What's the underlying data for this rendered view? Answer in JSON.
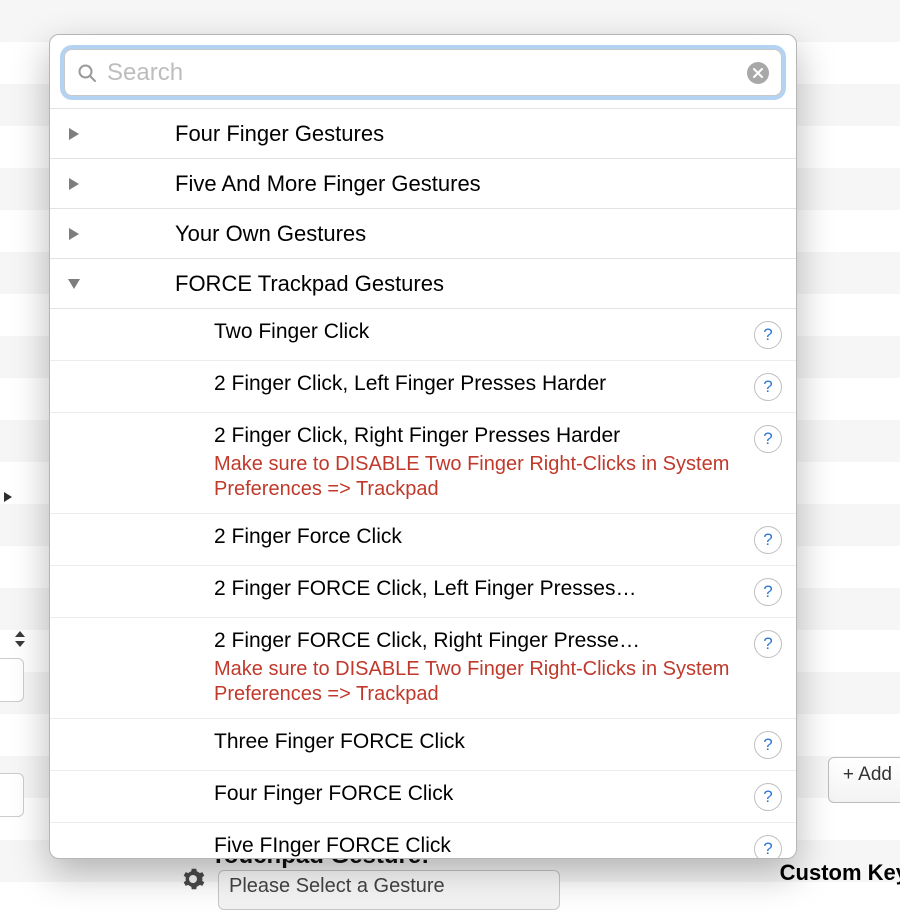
{
  "search": {
    "placeholder": "Search",
    "value": ""
  },
  "sections": [
    {
      "label": "Four Finger Gestures",
      "expanded": false
    },
    {
      "label": "Five And More Finger Gestures",
      "expanded": false
    },
    {
      "label": "Your Own Gestures",
      "expanded": false
    },
    {
      "label": "FORCE Trackpad Gestures",
      "expanded": true
    }
  ],
  "force_items": [
    {
      "title": "Two Finger Click",
      "note": ""
    },
    {
      "title": "2 Finger Click, Left Finger Presses Harder",
      "note": ""
    },
    {
      "title": "2 Finger Click, Right Finger Presses Harder",
      "note": "Make sure to DISABLE Two Finger Right-Clicks in System Preferences => Trackpad"
    },
    {
      "title": "2 Finger Force Click",
      "note": ""
    },
    {
      "title": "2 Finger FORCE Click, Left Finger Presses…",
      "note": ""
    },
    {
      "title": "2 Finger FORCE Click, Right Finger Presse…",
      "note": "Make sure to DISABLE Two Finger Right-Clicks in System Preferences => Trackpad"
    },
    {
      "title": "Three Finger FORCE Click",
      "note": ""
    },
    {
      "title": "Four Finger FORCE Click",
      "note": ""
    },
    {
      "title": "Five FInger FORCE Click",
      "note": ""
    }
  ],
  "help_glyph": "?",
  "add_button_label": "+ Add ",
  "bottom": {
    "label": "Touchpad Gesture:",
    "select_placeholder": "Please Select a Gesture",
    "keyboard_label": "Custom Key"
  }
}
